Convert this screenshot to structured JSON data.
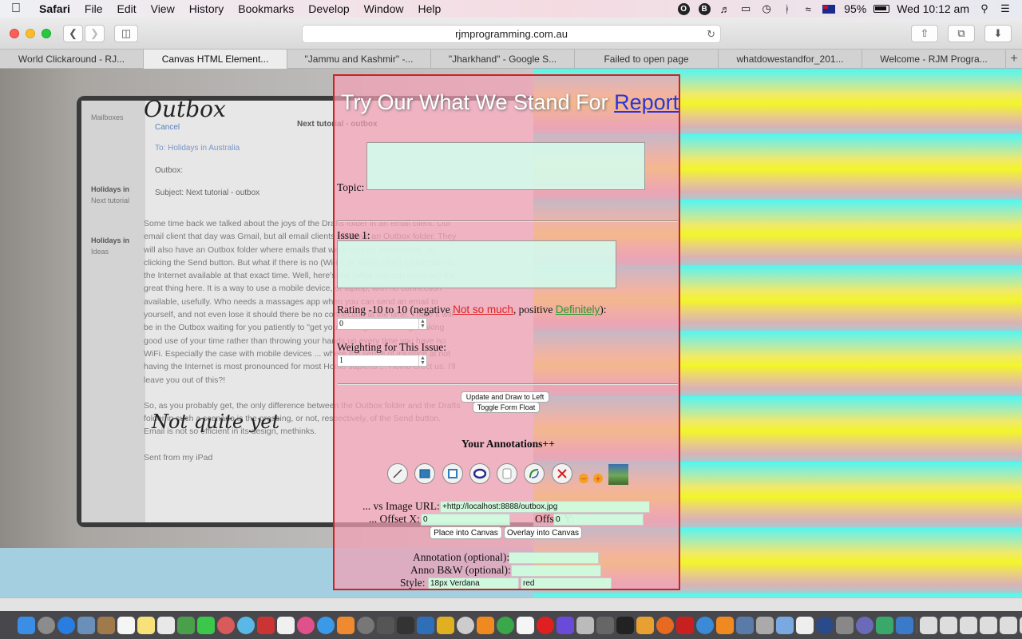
{
  "menubar": {
    "app": "Safari",
    "items": [
      "File",
      "Edit",
      "View",
      "History",
      "Bookmarks",
      "Develop",
      "Window",
      "Help"
    ],
    "battery": "95%",
    "clock": "Wed 10:12 am"
  },
  "toolbar": {
    "address": "rjmprogramming.com.au"
  },
  "tabs": [
    "World Clickaround - RJ...",
    "Canvas HTML Element...",
    "\"Jammu and Kashmir\" -...",
    "\"Jharkhand\" - Google S...",
    "Failed to open page",
    "whatdowestandfor_201...",
    "Welcome - RJM Progra..."
  ],
  "photo": {
    "handwriting_top": "Outbox",
    "handwriting_bottom": "Not quite yet",
    "ipad": {
      "nav_back": "Mailboxes",
      "cancel": "Cancel",
      "title": "Next tutorial - outbox",
      "to": "To: Holidays in Australia",
      "cc": "Outbox:",
      "subject": "Subject: Next tutorial - outbox",
      "sidebar_1": "Holidays in",
      "sidebar_2": "Next tutorial",
      "sidebar_3": "Holidays in",
      "sidebar_4": "Ideas",
      "body": "Some time back we talked about the joys of the Drafts folder in an email client. Our email client that day was Gmail, but all email clients will have an Outbox folder. They will also have an Outbox folder where emails that were sent go immediately on clicking the Send button. But what if there is no (Wi-Fi, or some other) connection to the Internet available at that exact time. Well, here's the (what you can make be) the great thing here. It is a way to use a mobile device, or laptop, with no connection available, usefully. Who needs a massages app when you can send an email to yourself, and not even lose it should there be no connection at the time. There it will be in the Outbox waiting for you patiently to \"get your act together\" along, making good use of your time rather than throwing your hands up every time you have no WiFi. Especially the case with mobile devices ... where the sense of injustice at not having the Internet is most pronounced for most Homo sapiens ... Homo erect us. I'll leave you out of this?!",
      "body2": "So, as you probably get, the only difference between the Outbox folder and the Drafts folder in such a scenario is the pressing, or not, respectively, of the Send button. Email is not so efficient in its design, methinks.",
      "signature": "Sent from my iPad"
    }
  },
  "form": {
    "title": "Try Our What We Stand For",
    "title_link": "Report",
    "topic_label": "Topic:",
    "issue_label": "Issue 1:",
    "rating_prefix": "Rating -10 to 10 (negative",
    "rating_negative": "Not so much",
    "rating_mid": ", positive",
    "rating_positive": "Definitely",
    "rating_suffix": "):",
    "rating_value": "0",
    "weighting_label": "Weighting for This Issue:",
    "weighting_value": "1",
    "update_button": "Update and Draw to Left",
    "toggle_button": "Toggle Form Float",
    "annotations_heading": "Your Annotations++",
    "image_url_label": "... vs Image URL:",
    "image_url_value": "+http://localhost:8888/outbox.jpg",
    "offset_x_label": "... Offset X:",
    "offset_x_value": "0",
    "offset_y_label": "Offset Y:",
    "offset_y_value": "0",
    "place_button": "Place into Canvas",
    "overlay_button": "Overlay into Canvas",
    "annotation_label": "Annotation (optional):",
    "anno_bw_label": "Anno B&W (optional):",
    "style_label": "Style:",
    "style_font_value": "18px Verdana",
    "style_color_value": "red",
    "tools": [
      "line-tool-icon",
      "filled-rect-tool-icon",
      "rect-tool-icon",
      "ellipse-tool-icon",
      "rounded-rect-tool-icon",
      "curve-tool-icon",
      "clear-tool-icon"
    ]
  }
}
